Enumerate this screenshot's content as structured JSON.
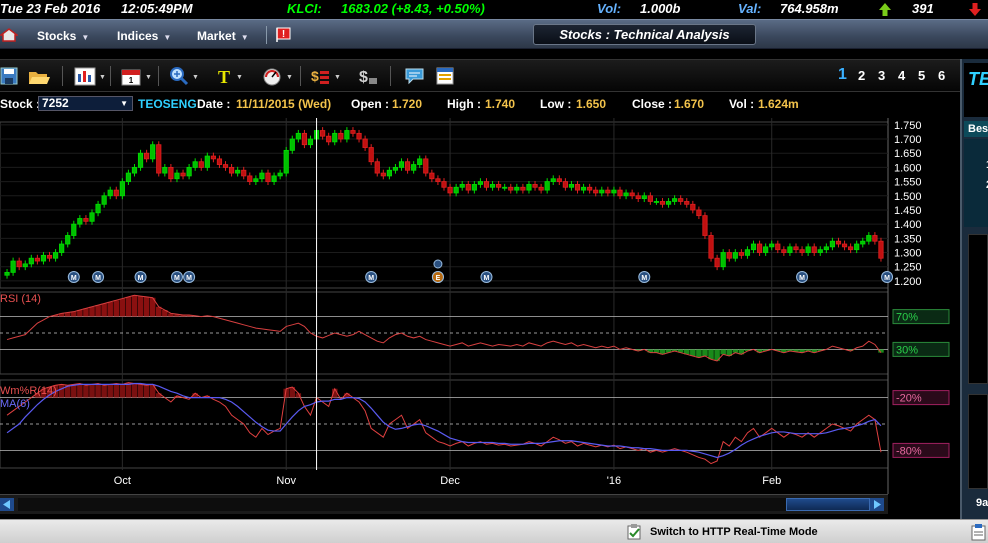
{
  "ticker": {
    "date": "Tue 23 Feb 2016",
    "time": "12:05:49PM",
    "klci_label": "KLCI:",
    "klci_value": "1683.02 (+8.43, +0.50%)",
    "vol_label": "Vol:",
    "vol_value": "1.000b",
    "val_label": "Val:",
    "val_value": "764.958m",
    "up_count": "391",
    "colors": {
      "up": "#00ff00",
      "label": "#66b3ff"
    }
  },
  "menubar": {
    "home_icon": "home-icon",
    "items": [
      "Stocks",
      "Indices",
      "Market"
    ],
    "alert_icon": "alert-flag-icon",
    "page_title": "Stocks : Technical Analysis"
  },
  "toolbar": {
    "tools": [
      "save-icon",
      "open-icon",
      "chart-type-icon",
      "calendar-icon",
      "zoom-icon",
      "text-tool-icon",
      "gauge-icon",
      "currency-icon",
      "dollar-icon",
      "comment-icon",
      "table-icon"
    ],
    "pages": [
      "1",
      "2",
      "3",
      "4",
      "5",
      "6"
    ],
    "active_page": "1"
  },
  "infobar": {
    "stock_label": "Stock :",
    "stock_code": "7252",
    "stock_name": "TEOSENG",
    "date_label": "Date :",
    "date_value": "11/11/2015 (Wed)",
    "open_label": "Open :",
    "open_value": "1.720",
    "high_label": "High :",
    "high_value": "1.740",
    "low_label": "Low :",
    "low_value": "1.650",
    "close_label": "Close :",
    "close_value": "1.670",
    "vol_label": "Vol :",
    "vol_value": "1.624m"
  },
  "chart_data": [
    {
      "type": "candlestick",
      "title": "",
      "y_ticks": [
        "1.750",
        "1.700",
        "1.650",
        "1.600",
        "1.550",
        "1.500",
        "1.450",
        "1.400",
        "1.350",
        "1.300",
        "1.250",
        "1.200"
      ],
      "ylim": [
        1.175,
        1.76
      ],
      "x_ticks": [
        "Oct",
        "Nov",
        "Dec",
        "'16",
        "Feb"
      ],
      "x_tick_index": [
        19,
        46,
        73,
        100,
        126
      ],
      "markers": [
        {
          "label": "M",
          "index": 11
        },
        {
          "label": "M",
          "index": 15
        },
        {
          "label": "M",
          "index": 22
        },
        {
          "label": "M",
          "index": 28
        },
        {
          "label": "M",
          "index": 30
        },
        {
          "label": "M",
          "index": 60
        },
        {
          "label": "M",
          "index": 71
        },
        {
          "label": "E",
          "index": 71
        },
        {
          "label": "M",
          "index": 79
        },
        {
          "label": "M",
          "index": 105
        },
        {
          "label": "M",
          "index": 131
        },
        {
          "label": "M",
          "index": 145
        }
      ],
      "series": [
        {
          "close": [
            1.23,
            1.27,
            1.25,
            1.26,
            1.28,
            1.27,
            1.29,
            1.28,
            1.3,
            1.33,
            1.36,
            1.4,
            1.42,
            1.41,
            1.44,
            1.47,
            1.5,
            1.52,
            1.5,
            1.55,
            1.58,
            1.6,
            1.65,
            1.63,
            1.68,
            1.58,
            1.6,
            1.56,
            1.58,
            1.57,
            1.6,
            1.62,
            1.6,
            1.64,
            1.63,
            1.61,
            1.6,
            1.58,
            1.59,
            1.57,
            1.55,
            1.56,
            1.58,
            1.55,
            1.57,
            1.58,
            1.66,
            1.7,
            1.72,
            1.68,
            1.7,
            1.73,
            1.71,
            1.69,
            1.72,
            1.7,
            1.73,
            1.72,
            1.7,
            1.67,
            1.62,
            1.58,
            1.57,
            1.59,
            1.6,
            1.62,
            1.59,
            1.61,
            1.63,
            1.58,
            1.56,
            1.55,
            1.53,
            1.51,
            1.53,
            1.54,
            1.52,
            1.54,
            1.55,
            1.53,
            1.54,
            1.53,
            1.53,
            1.52,
            1.53,
            1.52,
            1.54,
            1.53,
            1.52,
            1.55,
            1.56,
            1.55,
            1.53,
            1.54,
            1.52,
            1.53,
            1.52,
            1.51,
            1.52,
            1.51,
            1.52,
            1.5,
            1.51,
            1.5,
            1.49,
            1.5,
            1.48,
            1.48,
            1.47,
            1.48,
            1.49,
            1.48,
            1.47,
            1.45,
            1.43,
            1.36,
            1.28,
            1.25,
            1.3,
            1.28,
            1.3,
            1.29,
            1.31,
            1.33,
            1.3,
            1.32,
            1.33,
            1.31,
            1.3,
            1.32,
            1.31,
            1.3,
            1.32,
            1.3,
            1.31,
            1.32,
            1.34,
            1.33,
            1.32,
            1.31,
            1.33,
            1.34,
            1.36,
            1.34,
            1.28
          ]
        }
      ]
    },
    {
      "type": "line",
      "title": "RSI (14)",
      "levels": [
        {
          "label": "70%",
          "value": 70
        },
        {
          "label": "30%",
          "value": 30
        }
      ],
      "ylim": [
        0,
        100
      ],
      "series": [
        {
          "name": "RSI (14)",
          "values": [
            42,
            44,
            46,
            48,
            55,
            62,
            66,
            70,
            72,
            74,
            75,
            76,
            78,
            80,
            82,
            84,
            86,
            88,
            90,
            92,
            94,
            96,
            95,
            94,
            93,
            82,
            78,
            74,
            73,
            72,
            72,
            71,
            70,
            71,
            70,
            68,
            66,
            64,
            62,
            60,
            58,
            56,
            55,
            54,
            53,
            52,
            58,
            60,
            62,
            58,
            50,
            46,
            44,
            47,
            50,
            48,
            46,
            48,
            52,
            48,
            44,
            40,
            38,
            44,
            48,
            50,
            46,
            44,
            46,
            42,
            40,
            38,
            36,
            34,
            36,
            38,
            34,
            36,
            38,
            36,
            34,
            36,
            35,
            34,
            36,
            34,
            38,
            36,
            34,
            38,
            40,
            38,
            36,
            38,
            34,
            36,
            34,
            32,
            34,
            32,
            34,
            30,
            32,
            30,
            28,
            30,
            26,
            26,
            24,
            26,
            28,
            26,
            24,
            22,
            20,
            22,
            18,
            16,
            24,
            22,
            26,
            24,
            28,
            30,
            26,
            28,
            30,
            28,
            26,
            28,
            27,
            26,
            28,
            26,
            28,
            30,
            34,
            32,
            30,
            28,
            32,
            34,
            40,
            36,
            26
          ]
        }
      ]
    },
    {
      "type": "line",
      "title": "Wm%R(14)",
      "levels": [
        {
          "label": "-20%",
          "value": -20
        },
        {
          "label": "-80%",
          "value": -80
        }
      ],
      "ylim": [
        -100,
        0
      ],
      "series": [
        {
          "name": "Wm%R(14)",
          "values": [
            -40,
            -35,
            -30,
            -25,
            -20,
            -15,
            -10,
            -8,
            -6,
            -5,
            -6,
            -5,
            -4,
            -6,
            -5,
            -4,
            -6,
            -5,
            -4,
            -5,
            -3,
            -4,
            -5,
            -6,
            -5,
            -15,
            -20,
            -25,
            -18,
            -20,
            -22,
            -15,
            -20,
            -18,
            -22,
            -25,
            -30,
            -40,
            -45,
            -50,
            -60,
            -65,
            -55,
            -62,
            -58,
            -55,
            -10,
            -8,
            -15,
            -30,
            -40,
            -20,
            -25,
            -30,
            -10,
            -22,
            -15,
            -20,
            -25,
            -35,
            -55,
            -60,
            -65,
            -50,
            -45,
            -40,
            -55,
            -50,
            -45,
            -60,
            -65,
            -70,
            -72,
            -75,
            -72,
            -70,
            -75,
            -72,
            -70,
            -73,
            -72,
            -74,
            -73,
            -75,
            -74,
            -73,
            -70,
            -72,
            -75,
            -70,
            -65,
            -68,
            -72,
            -70,
            -75,
            -72,
            -74,
            -76,
            -74,
            -76,
            -74,
            -78,
            -76,
            -78,
            -80,
            -78,
            -82,
            -80,
            -82,
            -80,
            -78,
            -80,
            -82,
            -85,
            -88,
            -90,
            -95,
            -92,
            -70,
            -75,
            -65,
            -70,
            -60,
            -55,
            -65,
            -60,
            -55,
            -60,
            -65,
            -60,
            -62,
            -65,
            -60,
            -65,
            -60,
            -55,
            -50,
            -52,
            -55,
            -58,
            -50,
            -45,
            -40,
            -45,
            -82
          ]
        },
        {
          "name": "MA(6)",
          "values": [
            -60,
            -55,
            -50,
            -42,
            -35,
            -28,
            -22,
            -17,
            -13,
            -10,
            -7,
            -6,
            -5,
            -5,
            -5,
            -5,
            -5,
            -5,
            -5,
            -5,
            -5,
            -4,
            -4,
            -5,
            -5,
            -7,
            -10,
            -13,
            -15,
            -18,
            -20,
            -20,
            -20,
            -20,
            -20,
            -20,
            -22,
            -25,
            -30,
            -36,
            -42,
            -48,
            -53,
            -57,
            -58,
            -58,
            -50,
            -42,
            -35,
            -30,
            -28,
            -25,
            -24,
            -24,
            -22,
            -22,
            -20,
            -20,
            -21,
            -25,
            -32,
            -40,
            -48,
            -53,
            -56,
            -55,
            -53,
            -51,
            -50,
            -52,
            -55,
            -58,
            -62,
            -66,
            -68,
            -70,
            -71,
            -71,
            -71,
            -71,
            -71,
            -72,
            -72,
            -73,
            -73,
            -73,
            -72,
            -72,
            -72,
            -71,
            -70,
            -69,
            -69,
            -69,
            -70,
            -71,
            -72,
            -73,
            -74,
            -75,
            -75,
            -75,
            -76,
            -77,
            -77,
            -78,
            -78,
            -79,
            -80,
            -80,
            -80,
            -80,
            -80,
            -81,
            -82,
            -84,
            -86,
            -88,
            -86,
            -83,
            -79,
            -74,
            -70,
            -67,
            -64,
            -62,
            -60,
            -59,
            -59,
            -60,
            -61,
            -61,
            -61,
            -61,
            -61,
            -60,
            -58,
            -56,
            -55,
            -54,
            -52,
            -50,
            -47,
            -45,
            -52
          ]
        }
      ]
    }
  ],
  "scrollbar": {
    "left_arrow": "scroll-left-icon",
    "right_arrow": "scroll-right-icon"
  },
  "right_panel": {
    "head": "TE",
    "best_label": "Bes",
    "row1": "1",
    "row2": "2",
    "time_label": "9a"
  },
  "statusbar": {
    "http_text": "Switch to HTTP Real-Time Mode",
    "http_icon": "clipboard-check-icon",
    "clip_icon": "clipboard-icon"
  }
}
